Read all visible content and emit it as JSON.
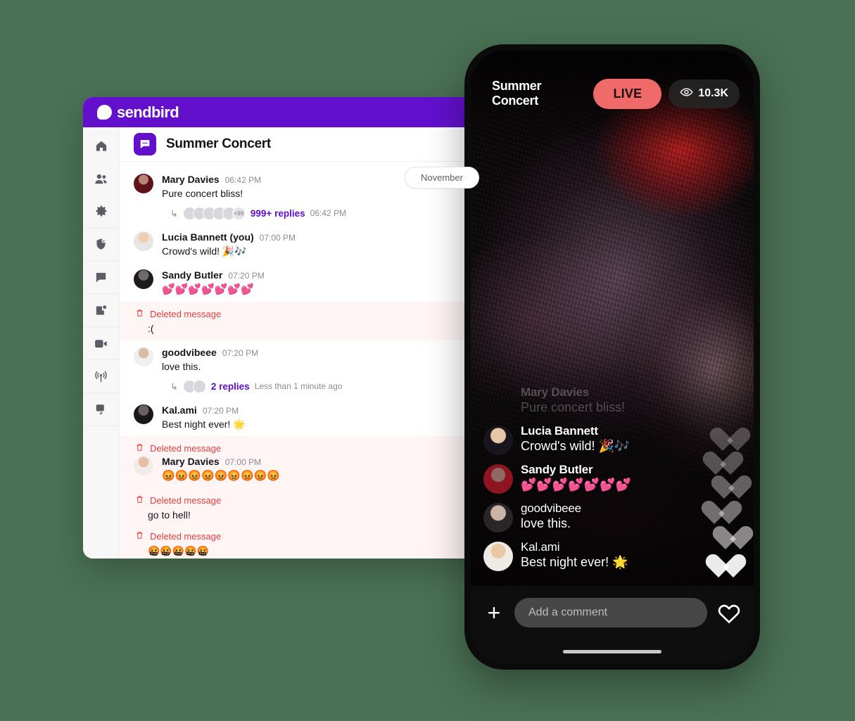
{
  "background_color": "#4a7154",
  "brand": {
    "primary_purple": "#6210cc",
    "deleted_red": "#e53e3e",
    "live_red": "#f16a6a"
  },
  "desktop": {
    "topbar": {
      "logo_text": "sendbird",
      "logo_icon": "sendbird-logo-icon"
    },
    "sidebar": {
      "items": [
        {
          "name": "home",
          "icon": "home-icon",
          "active": false
        },
        {
          "name": "users",
          "icon": "users-icon",
          "active": false
        },
        {
          "name": "settings",
          "icon": "gear-icon",
          "active": false
        },
        {
          "name": "moderation",
          "icon": "shield-check-icon",
          "active": false
        },
        {
          "name": "chat",
          "icon": "chat-bubble-icon",
          "active": false
        },
        {
          "name": "desk",
          "icon": "desk-icon",
          "active": false
        },
        {
          "name": "calls",
          "icon": "video-camera-icon",
          "active": false
        },
        {
          "name": "live",
          "icon": "broadcast-icon",
          "active": false
        },
        {
          "name": "ai-chatbot",
          "icon": "multi-chat-icon",
          "active": false
        }
      ]
    },
    "channel": {
      "title": "Summer Concert",
      "icon": "channel-chat-icon",
      "date_divider": "November"
    },
    "messages": [
      {
        "type": "normal",
        "avatar": "av-mary",
        "sender": "Mary Davies",
        "time": "06:42 PM",
        "text": "Pure concert bliss!",
        "thread": {
          "count_label": "999+ replies",
          "time": "06:42 PM",
          "avatars": 5,
          "overflow_badge": "+99"
        }
      },
      {
        "type": "normal",
        "avatar": "av-lucia",
        "sender": "Lucia Bannett (you)",
        "time": "07:00 PM",
        "text": "Crowd's wild! 🎉🎶"
      },
      {
        "type": "normal",
        "avatar": "av-sandy",
        "sender": "Sandy Butler",
        "time": "07:20 PM",
        "text": "💕💕💕💕💕💕💕"
      },
      {
        "type": "deleted",
        "label": "Deleted message",
        "text": ":("
      },
      {
        "type": "normal",
        "avatar": "av-good",
        "sender": "goodvibeee",
        "time": "07:20 PM",
        "text": "love this.",
        "thread": {
          "count_label": "2 replies",
          "time": "Less than 1 minute ago",
          "avatars": 2,
          "overflow_badge": ""
        }
      },
      {
        "type": "normal",
        "avatar": "av-kal",
        "sender": "Kal.ami",
        "time": "07:20 PM",
        "text": "Best night ever! 🌟"
      },
      {
        "type": "deleted-with-sender",
        "label": "Deleted message",
        "avatar": "av-mary2",
        "sender": "Mary Davies",
        "time": "07:00 PM",
        "text": "😡😡😡😡😡😡😡😡😡"
      },
      {
        "type": "deleted",
        "label": "Deleted message",
        "text": "go to hell!"
      },
      {
        "type": "deleted",
        "label": "Deleted message",
        "text": "🤬🤬🤬🤬🤬"
      }
    ]
  },
  "phone": {
    "title": "Summer Concert",
    "live_label": "LIVE",
    "viewer_count": "10.3K",
    "viewer_icon": "eye-icon",
    "live_messages": [
      {
        "sender": "Mary Davies",
        "text": "Pure concert bliss!",
        "faded": true,
        "avatar": "hidden-av"
      },
      {
        "sender": "Lucia Bannett",
        "text": "Crowd's wild! 🎉🎶",
        "faded": false,
        "avatar": "lcav-lucia",
        "bold_name": true
      },
      {
        "sender": "Sandy Butler",
        "text": "💕💕💕💕💕💕💕",
        "faded": false,
        "avatar": "lcav-sandy",
        "bold_name": true
      },
      {
        "sender": "goodvibeee",
        "text": "love this.",
        "faded": false,
        "avatar": "lcav-good",
        "bold_name": false
      },
      {
        "sender": "Kal.ami",
        "text": "Best night ever! 🌟",
        "faded": false,
        "avatar": "lcav-kal",
        "bold_name": false
      }
    ],
    "composer": {
      "add_icon": "plus-icon",
      "placeholder": "Add a comment",
      "value": "",
      "like_icon": "heart-icon"
    },
    "hearts_count": 6
  }
}
